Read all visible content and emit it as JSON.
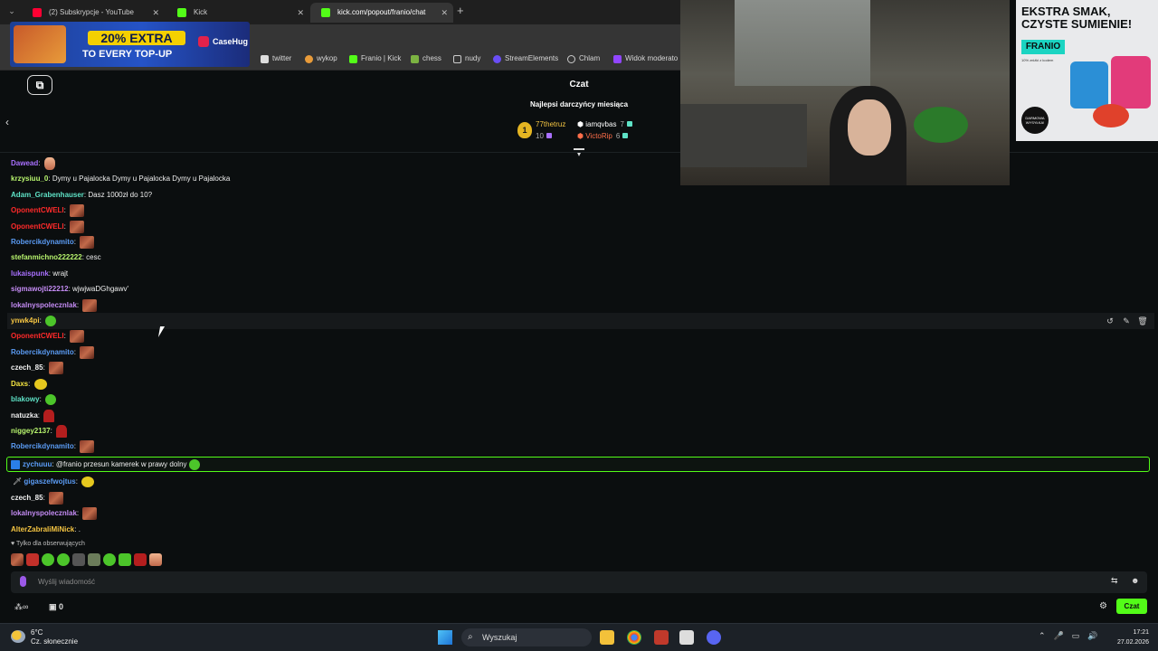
{
  "browser": {
    "tabs": [
      {
        "title": "(2) Subskrypcje - YouTube",
        "color": "#ff0033"
      },
      {
        "title": "Kick",
        "color": "#53fc18"
      },
      {
        "title": "kick.com/popout/franio/chat",
        "color": "#53fc18"
      }
    ],
    "bookmarks": [
      "twitter",
      "wykop",
      "Franio | Kick",
      "chess",
      "nudy",
      "StreamElements",
      "Chlam",
      "Widok moderato"
    ]
  },
  "ad": {
    "line1": "20% EXTRA",
    "line2": "TO EVERY TOP-UP",
    "brand": "CaseHug"
  },
  "chat": {
    "title": "Czat",
    "top_donors_label": "Najlepsi darczyńcy miesiąca",
    "top1_rank": "1",
    "top1_name": "77thetruz",
    "top1_count": "10",
    "top2_name": "iamqvbas",
    "top2_count": "7",
    "top3_name": "VictoRip",
    "top3_count": "6",
    "messages": [
      {
        "user": "Dawead",
        "color": "#a970ff",
        "text": ""
      },
      {
        "user": "krzysiuu_0",
        "color": "#b8f56e",
        "text": "Dymy u Pajalocka  Dymy u Pajalocka  Dymy u Pajalocka"
      },
      {
        "user": "Adam_Grabenhauser",
        "color": "#5ee2c6",
        "text": "Dasz 1000zł do 10?"
      },
      {
        "user": "OponentCWELI",
        "color": "#ff2a2a",
        "text": ""
      },
      {
        "user": "OponentCWELI",
        "color": "#ff2a2a",
        "text": ""
      },
      {
        "user": "Robercikdynamito",
        "color": "#5b9cf5",
        "text": ""
      },
      {
        "user": "stefanmichno222222",
        "color": "#b8f56e",
        "text": "cesc"
      },
      {
        "user": "lukaispunk",
        "color": "#a970ff",
        "text": "wrajt"
      },
      {
        "user": "sigmawojti22212",
        "color": "#c58cf5",
        "text": "wjwjwaDGhgawv'"
      },
      {
        "user": "lokalnyspolecznlak",
        "color": "#c58cf5",
        "text": ""
      },
      {
        "user": "ynwk4pi",
        "color": "#f5c542",
        "text": ""
      },
      {
        "user": "OponentCWELI",
        "color": "#ff2a2a",
        "text": ""
      },
      {
        "user": "Robercikdynamito",
        "color": "#5b9cf5",
        "text": ""
      },
      {
        "user": "czech_85",
        "color": "#efefef",
        "text": ""
      },
      {
        "user": "Daxs",
        "color": "#f5e642",
        "text": ""
      },
      {
        "user": "blakowy",
        "color": "#5ee2c6",
        "text": ""
      },
      {
        "user": "natuzka",
        "color": "#efefef",
        "text": ""
      },
      {
        "user": "niggey2137",
        "color": "#b8f56e",
        "text": ""
      },
      {
        "user": "Robercikdynamito",
        "color": "#5b9cf5",
        "text": ""
      },
      {
        "user": "zychuuu",
        "color": "#5b9cf5",
        "text": "@franio przesun kamerek w prawy dolny"
      },
      {
        "user": "gigaszefwojtus",
        "color": "#5b9cf5",
        "text": ""
      },
      {
        "user": "czech_85",
        "color": "#efefef",
        "text": ""
      },
      {
        "user": "lokalnyspolecznlak",
        "color": "#c58cf5",
        "text": ""
      },
      {
        "user": "AlterZabraliMiNick",
        "color": "#f5c542",
        "text": "."
      }
    ],
    "follow_note": "Tylko dla obserwujących",
    "input_placeholder": "Wyślij wiadomość",
    "points": "0",
    "send_label": "Czat"
  },
  "sponsor": {
    "headline": "EKSTRA SMAK, CZYSTE SUMIENIE!",
    "tag": "FRANIO",
    "sub": "10% zniżki z kodem",
    "badge": "DARMOWA WYSYŁKA!"
  },
  "taskbar": {
    "temp": "6°C",
    "weather": "Cz. słonecznie",
    "search": "Wyszukaj",
    "time": "17:21",
    "date": "27.02.2026"
  },
  "colors": {
    "kick_green": "#53fc18",
    "bg": "#0b0e0f"
  }
}
